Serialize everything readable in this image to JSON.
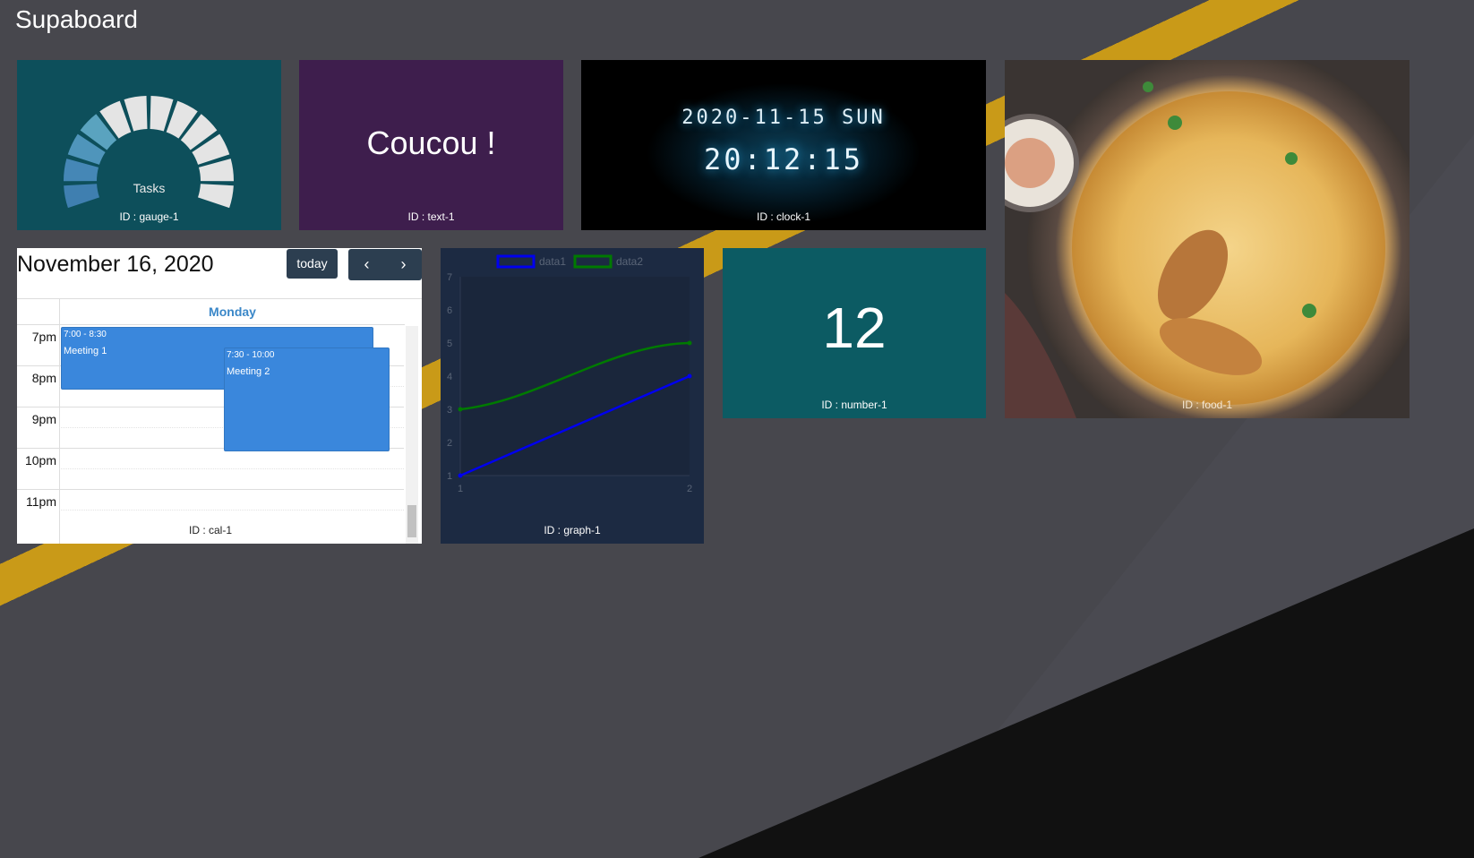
{
  "app": {
    "title": "Supaboard"
  },
  "gauge": {
    "label": "Tasks",
    "id_text": "ID : gauge-1",
    "filled_fraction": 0.3,
    "segments": 12
  },
  "text_widget": {
    "text": "Coucou !",
    "id_text": "ID : text-1"
  },
  "clock": {
    "date": "2020-11-15 SUN",
    "time": "20:12:15",
    "id_text": "ID : clock-1"
  },
  "food": {
    "id_text": "ID : food-1"
  },
  "number": {
    "value": "12",
    "id_text": "ID : number-1"
  },
  "calendar": {
    "title": "November 16, 2020",
    "today_label": "today",
    "prev_icon": "chevron-left-icon",
    "next_icon": "chevron-right-icon",
    "day_header": "Monday",
    "hours": [
      "7pm",
      "8pm",
      "9pm",
      "10pm",
      "11pm"
    ],
    "events": [
      {
        "time": "7:00 - 8:30",
        "name": "Meeting 1"
      },
      {
        "time": "7:30 - 10:00",
        "name": "Meeting 2"
      }
    ],
    "id_text": "ID : cal-1"
  },
  "graph": {
    "id_text": "ID : graph-1",
    "colors": {
      "data1": "#0000ee",
      "data2": "#007a00"
    }
  },
  "chart_data": {
    "type": "line",
    "x": [
      1,
      2
    ],
    "series": [
      {
        "name": "data1",
        "values": [
          1,
          4
        ]
      },
      {
        "name": "data2",
        "values": [
          3,
          5
        ]
      }
    ],
    "xlabel": "",
    "ylabel": "",
    "xticks": [
      "1",
      "2"
    ],
    "yticks": [
      "1",
      "2",
      "3",
      "4",
      "5",
      "6",
      "7"
    ],
    "ylim": [
      1,
      7
    ],
    "legend": "top-center"
  }
}
